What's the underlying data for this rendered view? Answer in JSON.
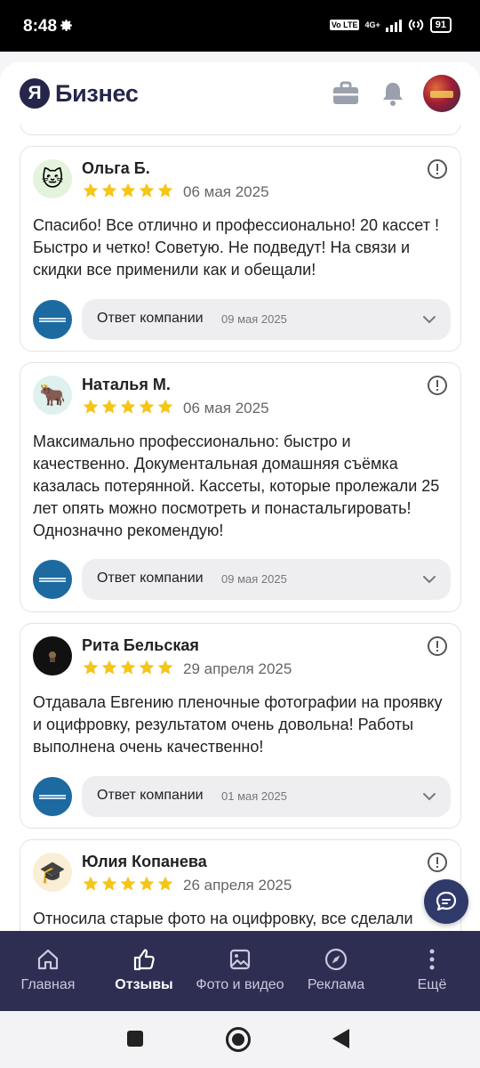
{
  "status_bar": {
    "time": "8:48",
    "network": "4G+",
    "lte": "Vo LTE",
    "battery": "91"
  },
  "app": {
    "logo_letter": "Я",
    "logo_text": "Бизнес"
  },
  "reviews": [
    {
      "name": "Ольга Б.",
      "date": "06 мая 2025",
      "rating": 5,
      "avatar_emoji": "🐱",
      "avatar_bg": "#e4f3dc",
      "text": "Спасибо! Все отлично и профессионально! 20 кассет ! Быстро и четко! Советую. Не подведут! На связи и скидки все применили как и обещали!",
      "reply_label": "Ответ компании",
      "reply_date": "09 мая 2025"
    },
    {
      "name": "Наталья М.",
      "date": "06 мая 2025",
      "rating": 5,
      "avatar_emoji": "🐂",
      "avatar_bg": "#dff1ee",
      "text": "Максимально профессионально: быстро и качественно. Документальная домашняя съёмка казалась потерянной. Кассеты, которые пролежали 25 лет опять можно посмотреть и понастальгировать! Однозначно рекомендую!",
      "reply_label": "Ответ компании",
      "reply_date": "09 мая 2025"
    },
    {
      "name": "Рита Бельская",
      "date": "29 апреля 2025",
      "rating": 5,
      "avatar_emoji": "",
      "avatar_bg": "#111111",
      "text": "Отдавала Евгению пленочные фотографии на проявку и оцифровку, результатом очень довольна! Работы выполнена очень качественно!",
      "reply_label": "Ответ компании",
      "reply_date": "01 мая 2025"
    },
    {
      "name": "Юлия Копанева",
      "date": "26 апреля 2025",
      "rating": 5,
      "avatar_emoji": "🎓",
      "avatar_bg": "#fbeed6",
      "text": "Относила старые фото на оцифровку, все сделали"
    }
  ],
  "nav": {
    "items": [
      {
        "label": "Главная",
        "icon": "home-icon"
      },
      {
        "label": "Отзывы",
        "icon": "thumbs-up-icon"
      },
      {
        "label": "Фото и видео",
        "icon": "image-icon"
      },
      {
        "label": "Реклама",
        "icon": "compass-icon"
      },
      {
        "label": "Ещё",
        "icon": "more-icon"
      }
    ],
    "active_index": 1
  },
  "colors": {
    "star": "#f5c518",
    "nav_bg": "#2e2d52",
    "brand": "#26264a",
    "company_logo": "#1d6aa0"
  }
}
